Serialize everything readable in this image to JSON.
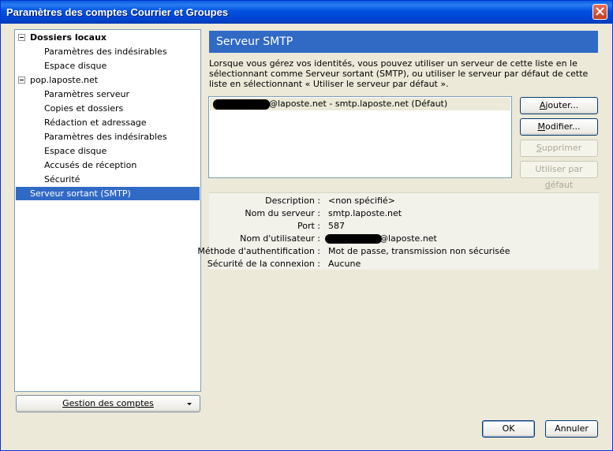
{
  "window": {
    "title": "Paramètres des comptes Courrier et Groupes",
    "close_icon": "close-icon"
  },
  "tree": {
    "local_folders": "Dossiers locaux",
    "local_junk": "Paramètres des indésirables",
    "local_disk": "Espace disque",
    "account": "pop.laposte.net",
    "server_settings": "Paramètres serveur",
    "copies_folders": "Copies et dossiers",
    "composition": "Rédaction et adressage",
    "account_junk": "Paramètres des indésirables",
    "account_disk": "Espace disque",
    "receipts": "Accusés de réception",
    "security": "Sécurité",
    "smtp": "Serveur sortant (SMTP)"
  },
  "account_actions": "Gestion des comptes",
  "panel": {
    "title": "Serveur SMTP",
    "description": "Lorsque vous gérez vos identités, vous pouvez utiliser un serveur de cette liste en le sélectionnant comme Serveur sortant (SMTP), ou utiliser le serveur par défaut de cette liste en sélectionnant « Utiliser le serveur par défaut ».",
    "server_entry": "@laposte.net - smtp.laposte.net (Défaut)"
  },
  "buttons": {
    "add_pre": "",
    "add_key": "A",
    "add_post": "jouter...",
    "edit_pre": "",
    "edit_key": "M",
    "edit_post": "odifier...",
    "remove_pre": "",
    "remove_key": "S",
    "remove_post": "upprimer",
    "default_pre": "Utiliser par ",
    "default_key": "d",
    "default_post": "éfaut",
    "ok": "OK",
    "cancel": "Annuler"
  },
  "details": {
    "description_label": "Description :",
    "description_value": "<non spécifié>",
    "server_label": "Nom du serveur :",
    "server_value": "smtp.laposte.net",
    "port_label": "Port :",
    "port_value": "587",
    "user_label": "Nom d'utilisateur :",
    "user_value": "@laposte.net",
    "auth_label": "Méthode d'authentification :",
    "auth_value": "Mot de passe, transmission non sécurisée",
    "security_label": "Sécurité de la connexion :",
    "security_value": "Aucune"
  }
}
